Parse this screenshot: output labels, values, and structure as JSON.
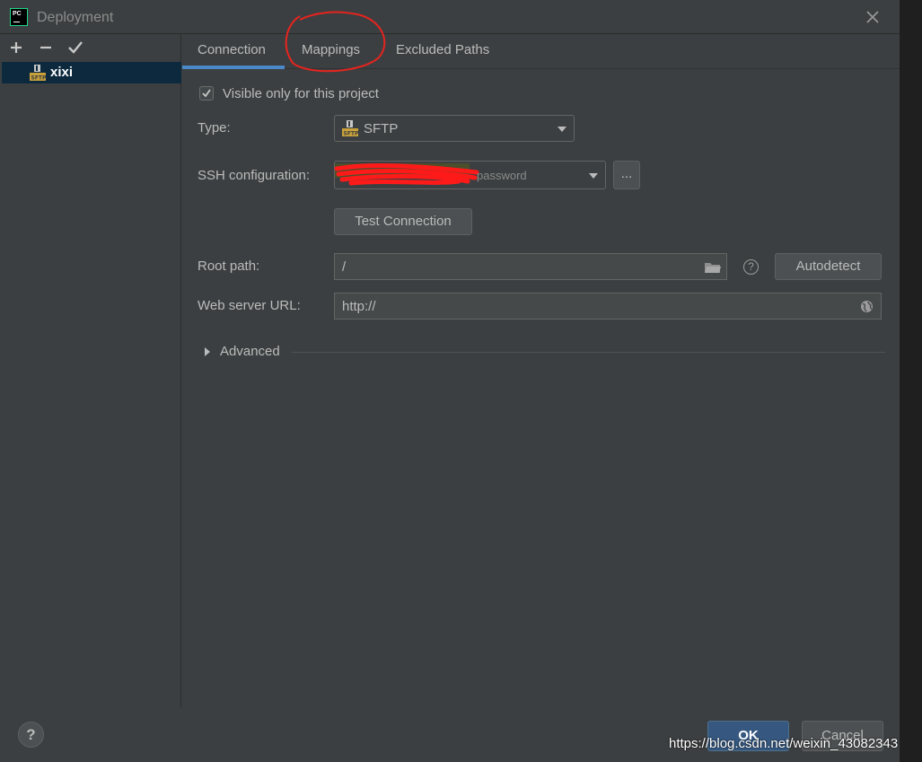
{
  "window": {
    "title": "Deployment",
    "app_logo_text": "PC"
  },
  "sidebar": {
    "toolbar": {
      "add": "+",
      "remove": "−",
      "apply": "✔"
    },
    "servers": [
      {
        "name": "xixi",
        "icon": "sftp-server-icon"
      }
    ]
  },
  "tabs": [
    {
      "label": "Connection",
      "selected": true
    },
    {
      "label": "Mappings",
      "selected": false
    },
    {
      "label": "Excluded Paths",
      "selected": false
    }
  ],
  "connection": {
    "visible_only_label": "Visible only for this project",
    "visible_only_checked": true,
    "type_label": "Type:",
    "type_value": "SFTP",
    "ssh_label": "SSH configuration:",
    "ssh_value_suffix": "password",
    "ssh_browse": "...",
    "test_connection": "Test Connection",
    "root_path_label": "Root path:",
    "root_path_value": "/",
    "help_glyph": "?",
    "autodetect": "Autodetect",
    "web_url_label": "Web server URL:",
    "web_url_value": "http://",
    "advanced_label": "Advanced"
  },
  "footer": {
    "help": "?",
    "ok": "OK",
    "cancel": "Cancel"
  },
  "watermark": "https://blog.csdn.net/weixin_43082343",
  "colors": {
    "background": "#3c3f41",
    "selection": "#0d293e",
    "accent": "#4a88c7",
    "ok_button": "#365880",
    "annotation": "#e5241f"
  }
}
